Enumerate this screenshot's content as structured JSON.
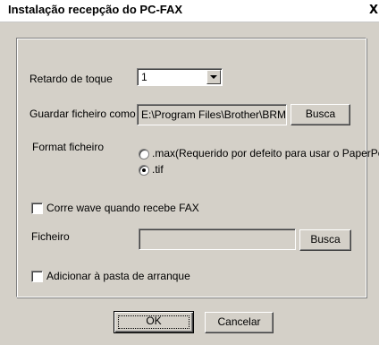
{
  "window": {
    "title": "Instalação recepção do PC-FAX",
    "close_glyph": "X"
  },
  "ring_delay": {
    "label": "Retardo de toque",
    "value": "1",
    "icon": "chevron-down-icon"
  },
  "save_file": {
    "label": "Guardar ficheiro como",
    "value": "E:\\Program Files\\Brother\\BRMFLP",
    "browse_label": "Busca"
  },
  "file_format": {
    "label": "Format ficheiro",
    "options": [
      {
        "label": ".max(Requerido por defeito para usar o PaperPort)",
        "selected": false
      },
      {
        "label": ".tif",
        "selected": true
      }
    ]
  },
  "play_wave": {
    "label": "Corre wave quando recebe FAX",
    "checked": false
  },
  "wave_file": {
    "label": "Ficheiro",
    "value": "",
    "browse_label": "Busca"
  },
  "startup": {
    "label": "Adicionar à pasta de arranque",
    "checked": false
  },
  "footer": {
    "ok_label": "OK",
    "cancel_label": "Cancelar"
  },
  "colors": {
    "dialog_face": "#d4d0c8",
    "titlebar": "#ffffff"
  }
}
